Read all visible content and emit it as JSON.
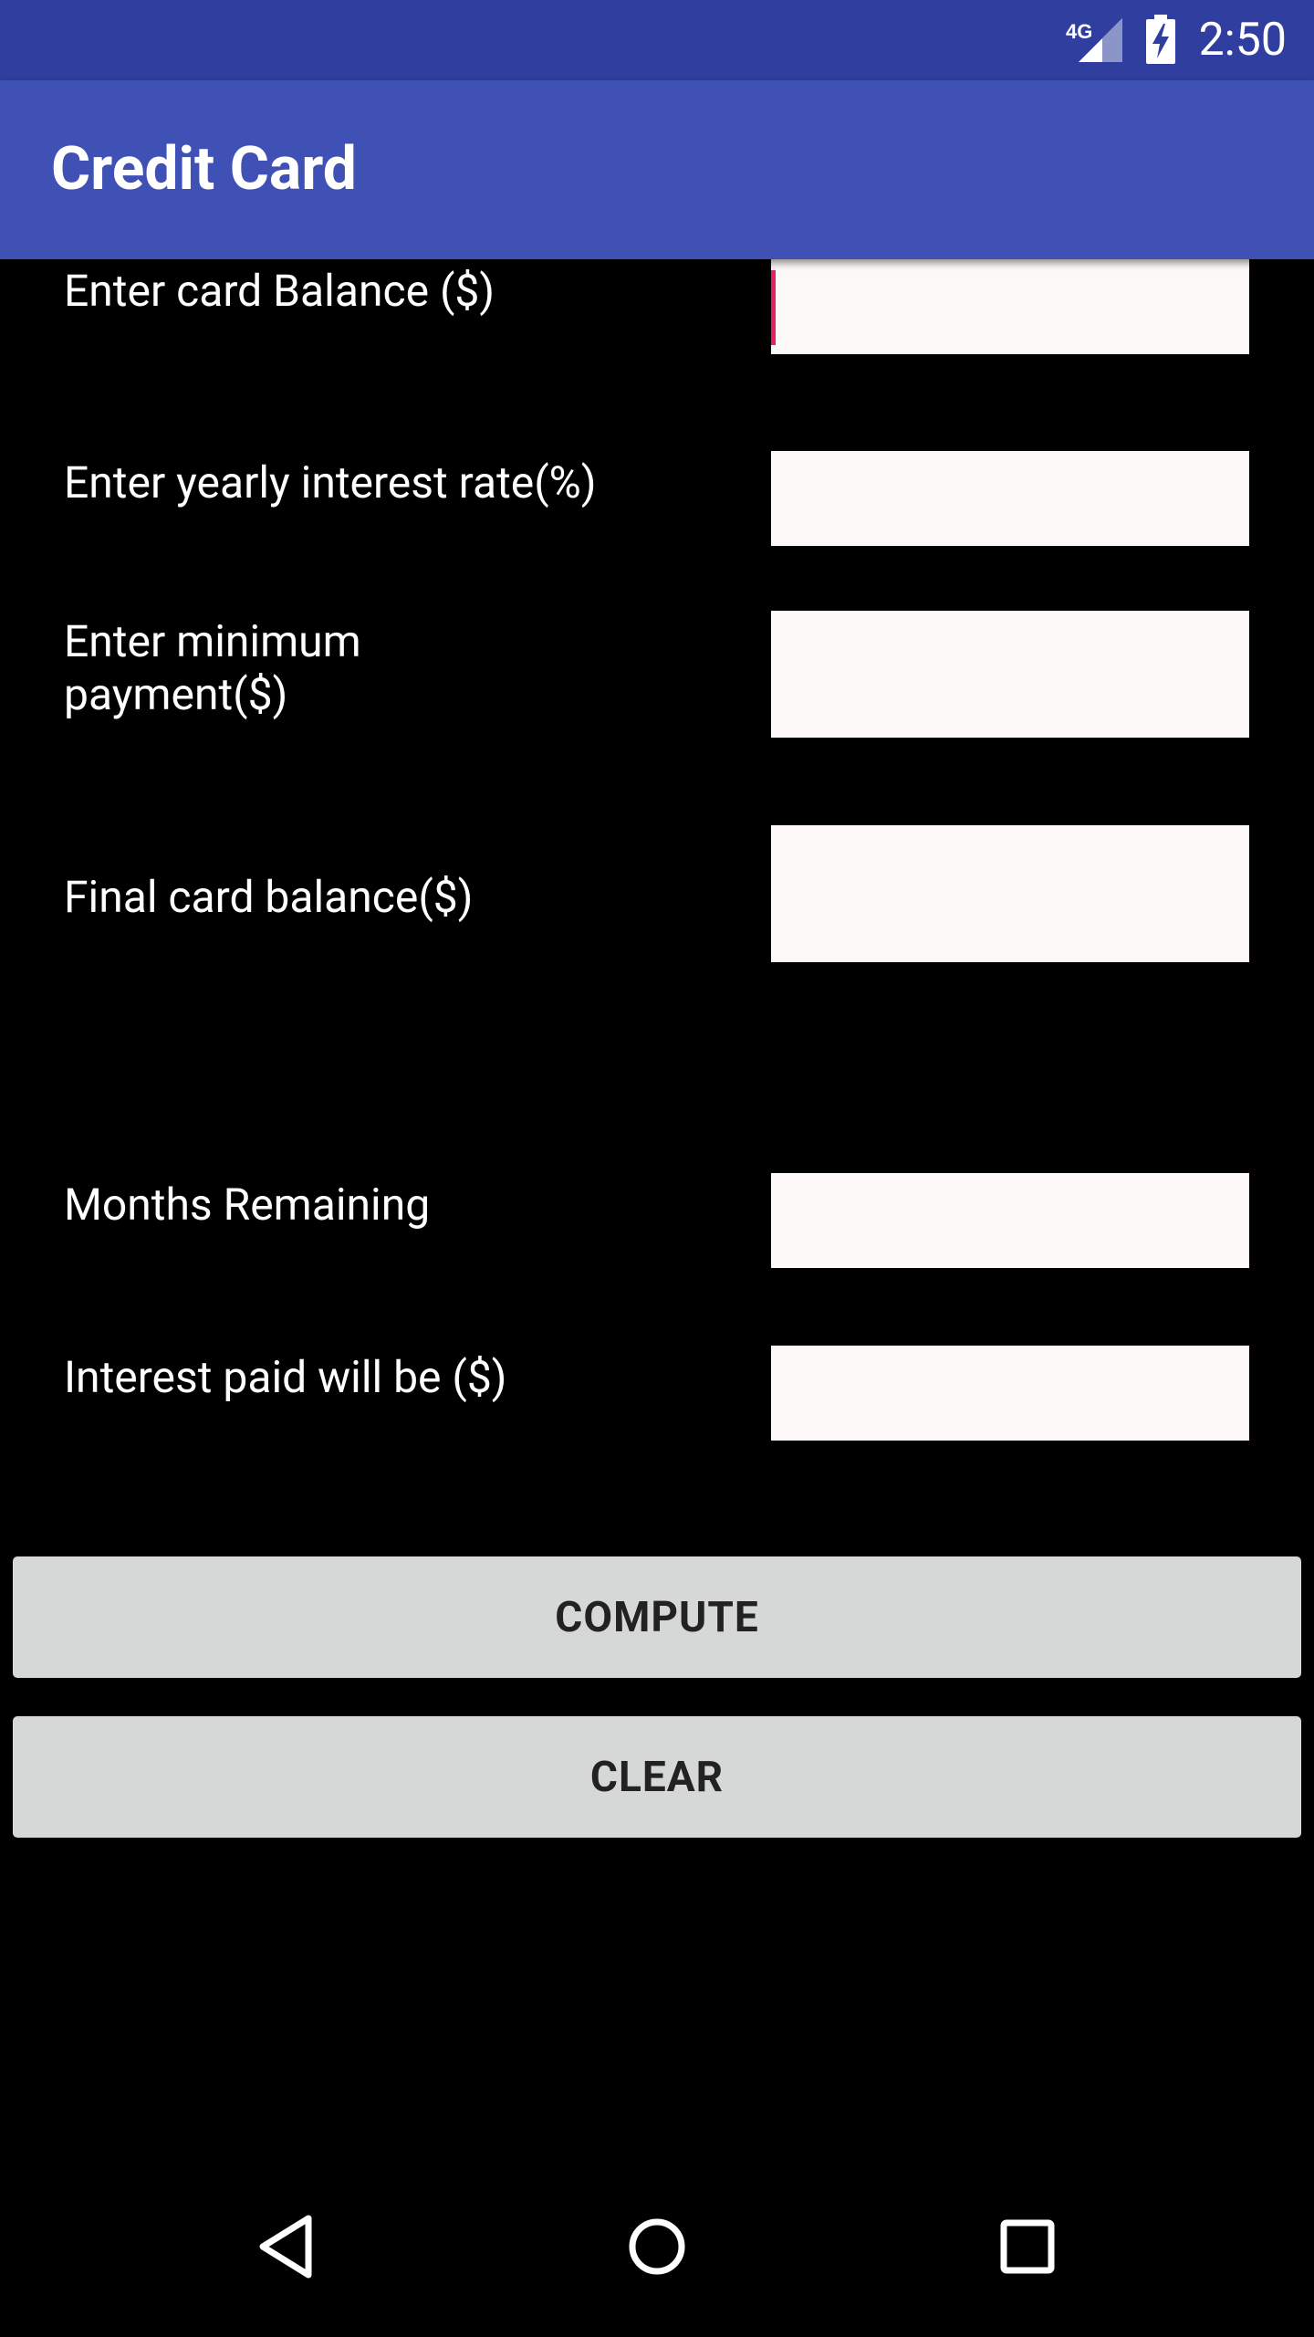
{
  "status_bar": {
    "network": "4G",
    "time": "2:50",
    "icons": [
      "signal-4g-icon",
      "battery-charging-icon"
    ]
  },
  "app_bar": {
    "title": "Credit Card"
  },
  "form": {
    "balance_label": "Enter card Balance ($)",
    "rate_label": "Enter yearly interest rate(%)",
    "min_payment_label_line1": "Enter minimum",
    "min_payment_label_line2": "payment($)",
    "final_balance_label": "Final card balance($)",
    "months_label": "Months Remaining",
    "interest_label": "Interest paid will be ($)"
  },
  "buttons": {
    "compute": "COMPUTE",
    "clear": "CLEAR"
  },
  "nav_bar": {
    "icons": [
      "back-icon",
      "home-icon",
      "recents-icon"
    ]
  },
  "colors": {
    "status_bar": "#303F9F",
    "app_bar": "#3F51B5",
    "accent": "#E91E63",
    "field_bg": "#FDF9F9",
    "button_bg": "#D6D7D7"
  }
}
